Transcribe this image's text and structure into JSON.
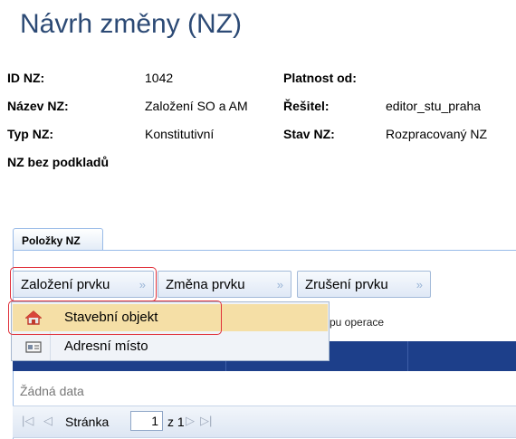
{
  "header": {
    "title": "Návrh změny (NZ)"
  },
  "details": {
    "id_label": "ID NZ:",
    "id_value": "1042",
    "name_label": "Název NZ:",
    "name_value": "Založení SO a AM",
    "type_label": "Typ NZ:",
    "type_value": "Konstitutivní",
    "nobasis_label": "NZ bez podkladů",
    "valid_label": "Platnost od:",
    "solver_label": "Řešitel:",
    "solver_value": "editor_stu_praha",
    "state_label": "Stav NZ:",
    "state_value": "Rozpracovaný NZ"
  },
  "tabs": [
    {
      "label": "Položky NZ",
      "active": true
    }
  ],
  "toolbar": {
    "create_label": "Založení prvku",
    "change_label": "Změna prvku",
    "cancel_label": "Zrušení prvku"
  },
  "menu": {
    "items": [
      {
        "label": "Stavební objekt",
        "icon": "house-icon",
        "highlighted": true
      },
      {
        "label": "Adresní místo",
        "icon": "address-card-icon",
        "highlighted": false
      }
    ]
  },
  "behind_text": "pu operace",
  "grid": {
    "columns": [
      "",
      "",
      "Typ operace"
    ],
    "empty_text": "Žádná data"
  },
  "pager": {
    "page_label": "Stránka",
    "page_value": "1",
    "of_label": "z 1"
  },
  "colors": {
    "title": "#2c4a75",
    "grid_header": "#1d3f8a",
    "highlight_border": "#e0303a",
    "menu_hover": "#f5dfa6"
  }
}
